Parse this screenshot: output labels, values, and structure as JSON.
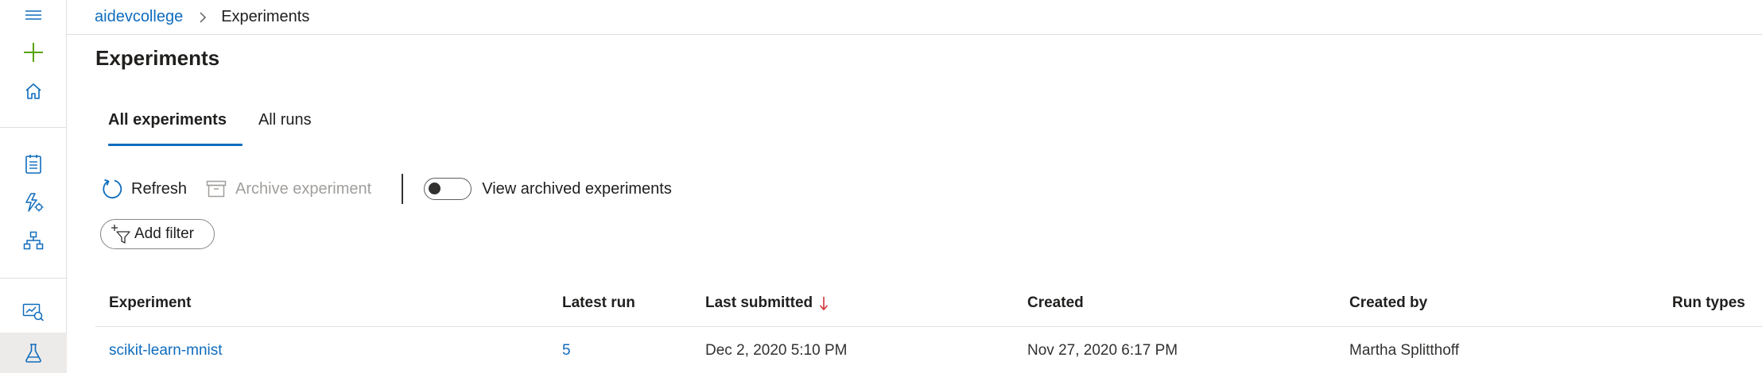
{
  "breadcrumb": {
    "workspace": "aidevcollege",
    "current": "Experiments"
  },
  "page": {
    "title": "Experiments"
  },
  "tabs": [
    {
      "label": "All experiments",
      "active": true
    },
    {
      "label": "All runs",
      "active": false
    }
  ],
  "toolbar": {
    "refresh_label": "Refresh",
    "archive_label": "Archive experiment",
    "archive_disabled": true,
    "view_archived_label": "View archived experiments",
    "view_archived_on": false
  },
  "filter": {
    "add_filter_label": "Add filter"
  },
  "table": {
    "columns": {
      "experiment": "Experiment",
      "latest_run": "Latest run",
      "last_submitted": "Last submitted",
      "created": "Created",
      "created_by": "Created by",
      "run_types": "Run types"
    },
    "sort_column": "last_submitted",
    "sort_direction": "descending",
    "rows": [
      {
        "experiment": "scikit-learn-mnist",
        "latest_run": "5",
        "last_submitted": "Dec 2, 2020 5:10 PM",
        "created": "Nov 27, 2020 6:17 PM",
        "created_by": "Martha Splitthoff",
        "run_types": ""
      }
    ]
  },
  "colors": {
    "accent": "#0f6cbd",
    "add_icon": "#57a300",
    "rail_icon": "#0f6cbd",
    "border": "#e1dfdd",
    "disabled_text": "#a19f9d"
  },
  "rail_icons": [
    "hamburger-icon",
    "plus-icon",
    "home-icon",
    "notebook-icon",
    "automl-icon",
    "designer-icon",
    "datasets-icon",
    "experiments-icon"
  ]
}
